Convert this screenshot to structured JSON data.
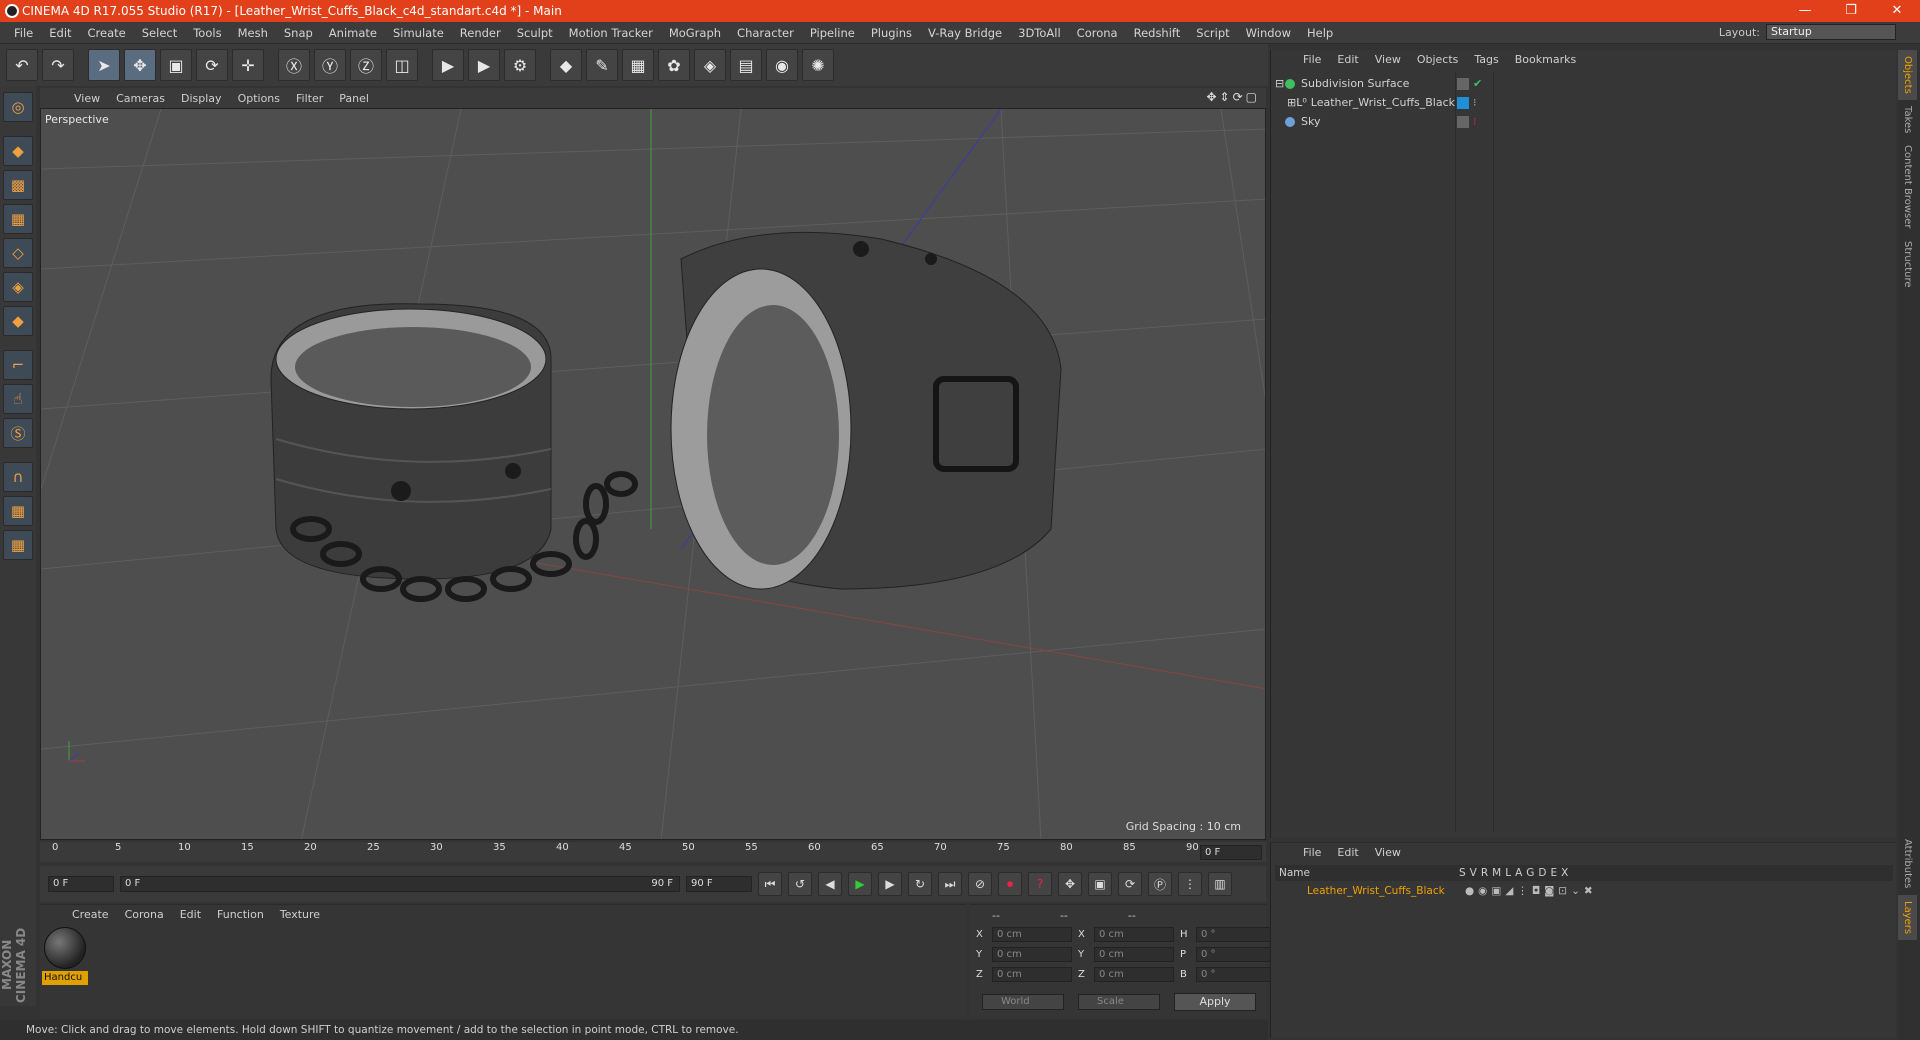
{
  "window": {
    "title": "CINEMA 4D R17.055 Studio (R17) - [Leather_Wrist_Cuffs_Black_c4d_standart.c4d *] - Main",
    "buttons": [
      "—",
      "❐",
      "✕"
    ]
  },
  "menubar": {
    "items": [
      "File",
      "Edit",
      "Create",
      "Select",
      "Tools",
      "Mesh",
      "Snap",
      "Animate",
      "Simulate",
      "Render",
      "Sculpt",
      "Motion Tracker",
      "MoGraph",
      "Character",
      "Pipeline",
      "Plugins",
      "V-Ray Bridge",
      "3DToAll",
      "Corona",
      "Redshift",
      "Script",
      "Window",
      "Help"
    ],
    "layout_label": "Layout:",
    "layout_value": "Startup"
  },
  "viewport": {
    "menu": [
      "View",
      "Cameras",
      "Display",
      "Options",
      "Filter",
      "Panel"
    ],
    "label": "Perspective",
    "grid_spacing": "Grid Spacing : 10 cm"
  },
  "timeline": {
    "ticks": [
      "0",
      "5",
      "10",
      "15",
      "20",
      "25",
      "30",
      "35",
      "40",
      "45",
      "50",
      "55",
      "60",
      "65",
      "70",
      "75",
      "80",
      "85",
      "90"
    ],
    "current_frame": "0 F"
  },
  "playbar": {
    "start": "0 F",
    "range_start": "0 F",
    "range_end": "90 F",
    "end": "90 F"
  },
  "material_panel": {
    "menu": [
      "Create",
      "Corona",
      "Edit",
      "Function",
      "Texture"
    ],
    "material_name": "Handcu"
  },
  "coords": {
    "headers": [
      "--",
      "--",
      "--"
    ],
    "rows": [
      {
        "l1": "X",
        "v1": "0 cm",
        "l2": "X",
        "v2": "0 cm",
        "l3": "H",
        "v3": "0 °"
      },
      {
        "l1": "Y",
        "v1": "0 cm",
        "l2": "Y",
        "v2": "0 cm",
        "l3": "P",
        "v3": "0 °"
      },
      {
        "l1": "Z",
        "v1": "0 cm",
        "l2": "Z",
        "v2": "0 cm",
        "l3": "B",
        "v3": "0 °"
      }
    ],
    "dropdown1": "World",
    "dropdown2": "Scale",
    "apply": "Apply"
  },
  "status": "Move: Click and drag to move elements. Hold down SHIFT to quantize movement / add to the selection in point mode, CTRL to remove.",
  "object_manager": {
    "menu": [
      "File",
      "Edit",
      "View",
      "Objects",
      "Tags",
      "Bookmarks"
    ],
    "objects": [
      "Subdivision Surface",
      "Leather_Wrist_Cuffs_Black",
      "Sky"
    ]
  },
  "layer_manager": {
    "menu": [
      "File",
      "Edit",
      "View"
    ],
    "name_header": "Name",
    "columns": [
      "S",
      "V",
      "R",
      "M",
      "L",
      "A",
      "G",
      "D",
      "E",
      "X"
    ],
    "layer": "Leather_Wrist_Cuffs_Black"
  },
  "right_tabs": [
    "Objects",
    "Takes",
    "Content Browser",
    "Structure",
    "Attributes",
    "Layers"
  ],
  "colors": {
    "titlebar": "#e1401a",
    "accent": "#f0a000"
  }
}
